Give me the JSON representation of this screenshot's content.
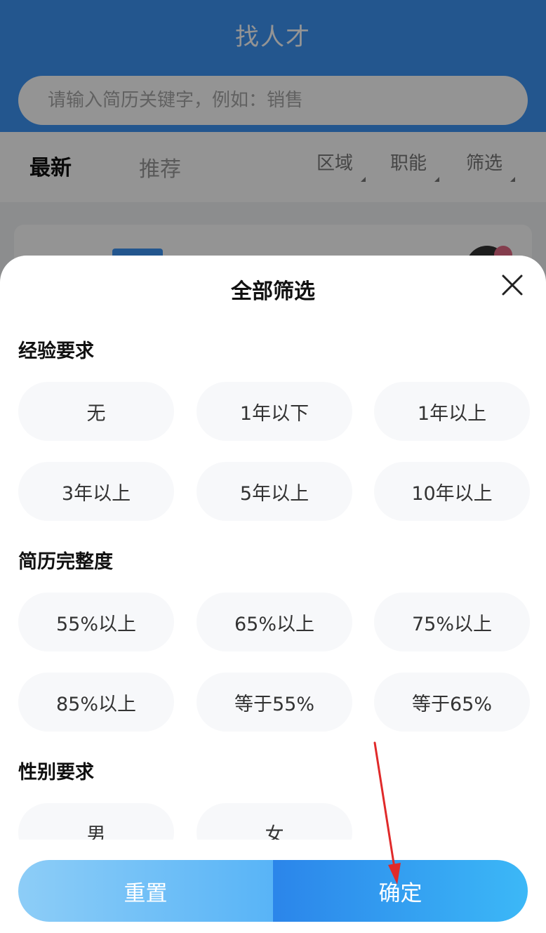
{
  "app": {
    "title": "找人才"
  },
  "search": {
    "placeholder": "请输入简历关键字，例如：销售"
  },
  "tabs": {
    "latest": "最新",
    "recommend": "推荐"
  },
  "filters": {
    "area": "区域",
    "function": "职能",
    "filter": "筛选"
  },
  "sheet": {
    "title": "全部筛选",
    "sections": [
      {
        "title": "经验要求",
        "options": [
          "无",
          "1年以下",
          "1年以上",
          "3年以上",
          "5年以上",
          "10年以上"
        ]
      },
      {
        "title": "简历完整度",
        "options": [
          "55%以上",
          "65%以上",
          "75%以上",
          "85%以上",
          "等于55%",
          "等于65%"
        ]
      },
      {
        "title": "性别要求",
        "options": [
          "男",
          "女"
        ]
      }
    ],
    "reset_label": "重置",
    "confirm_label": "确定"
  },
  "colors": {
    "primary": "#3d94f5",
    "chip_bg": "#f7f8fa",
    "annotation_arrow": "#e02a2a"
  },
  "icons": {
    "close": "close-icon",
    "caret": "caret-down-icon"
  }
}
